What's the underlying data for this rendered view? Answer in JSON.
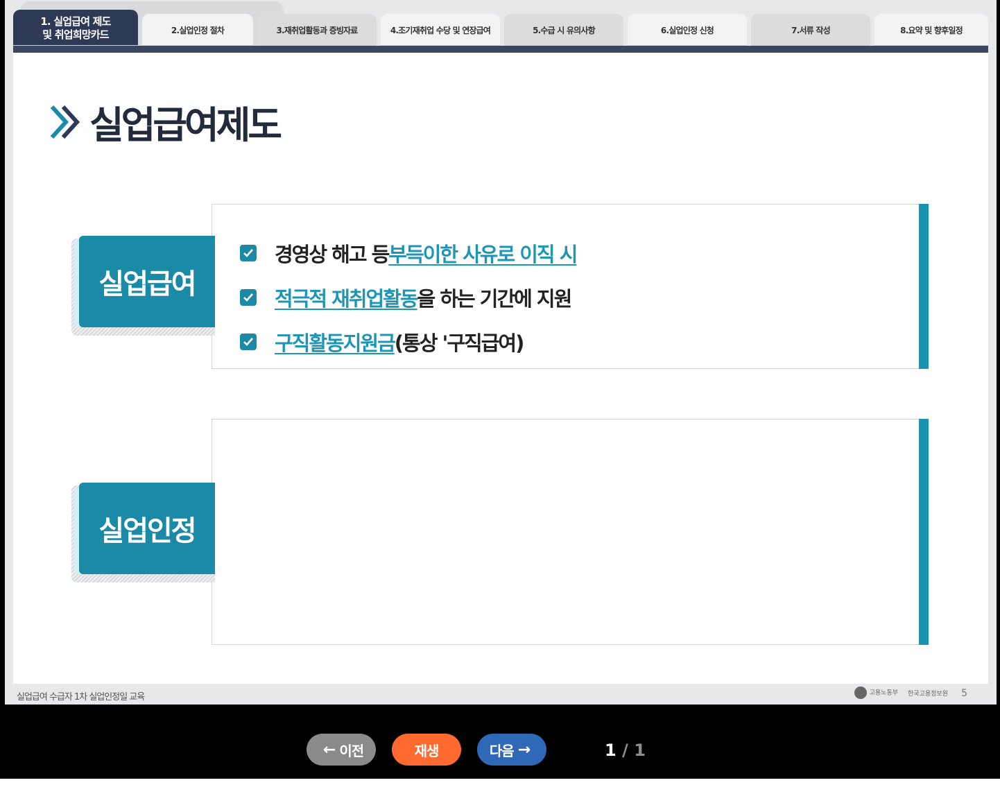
{
  "tabs": [
    {
      "label": "1. 실업급여 제도\n및 취업희망카드",
      "active": true
    },
    {
      "label": "2.실업인정 절차"
    },
    {
      "label": "3.재취업활동과 증빙자료"
    },
    {
      "label": "4.조기재취업 수당 및 연장급여"
    },
    {
      "label": "5.수급 시 유의사항"
    },
    {
      "label": "6.실업인정 신청"
    },
    {
      "label": "7.서류 작성"
    },
    {
      "label": "8.요약 및 향후일정"
    }
  ],
  "page_title": "실업급여제도",
  "sections": {
    "benefit": {
      "label": "실업급여",
      "bullets": [
        {
          "pre": "경영상 해고 등 ",
          "link": "부득이한 사유로 이직 시",
          "post": ""
        },
        {
          "pre": "",
          "link": "적극적 재취업활동",
          "post": "을 하는 기간에 지원"
        },
        {
          "pre": "",
          "link": "구직활동지원금",
          "post": " (통상 '구직급여)"
        }
      ]
    },
    "recognition": {
      "label": "실업인정"
    }
  },
  "footer": {
    "text": "실업급여 수급자 1차 실업인정일 교육",
    "logo1": "고용노동부",
    "logo2": "한국고용정보원",
    "page_number": "5"
  },
  "controls": {
    "prev_label": "이전",
    "play_label": "재생",
    "next_label": "다음",
    "current": "1",
    "separator": "/",
    "total": "1"
  },
  "colors": {
    "accent": "#1b8aa6",
    "tab_active": "#2e3a55",
    "play": "#ff6a30",
    "next": "#3068b8",
    "prev": "#8a8a8a"
  }
}
